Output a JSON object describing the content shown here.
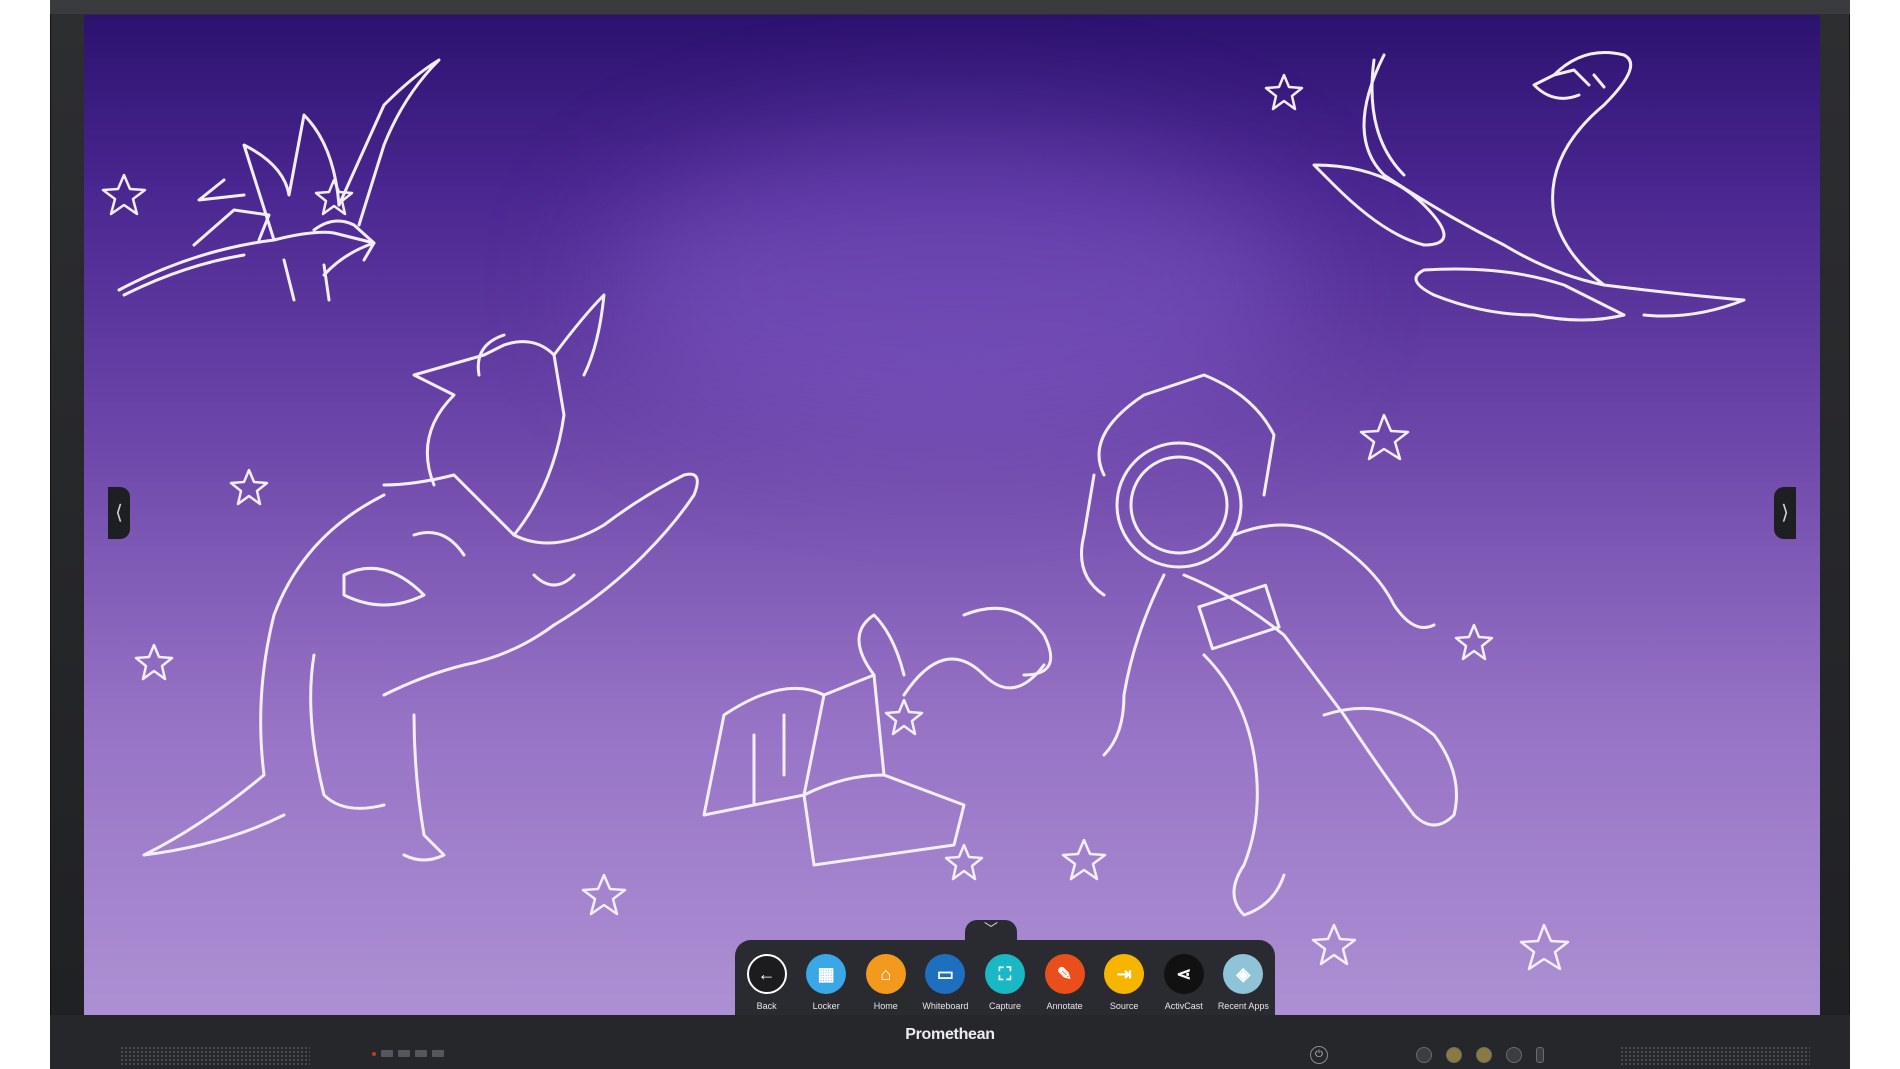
{
  "panel": {
    "brand": "Promethean"
  },
  "side_tabs": {
    "left_glyph": "⟨",
    "right_glyph": "⟩"
  },
  "dock": {
    "handle_glyph": "﹀",
    "items": [
      {
        "label": "Back",
        "icon": "back-arrow-icon",
        "color": "#1c1c1e",
        "glyph": "←"
      },
      {
        "label": "Locker",
        "icon": "locker-icon",
        "color": "#3aa7e6",
        "glyph": "▦"
      },
      {
        "label": "Home",
        "icon": "home-icon",
        "color": "#f39a1e",
        "glyph": "⌂"
      },
      {
        "label": "Whiteboard",
        "icon": "whiteboard-icon",
        "color": "#1f6fc0",
        "glyph": "▭"
      },
      {
        "label": "Capture",
        "icon": "capture-icon",
        "color": "#19b8c4",
        "glyph": "⛶"
      },
      {
        "label": "Annotate",
        "icon": "annotate-icon",
        "color": "#e94e1b",
        "glyph": "✎"
      },
      {
        "label": "Source",
        "icon": "source-icon",
        "color": "#f7b500",
        "glyph": "⇥"
      },
      {
        "label": "ActivCast",
        "icon": "share-icon",
        "color": "#111111",
        "glyph": "⋖"
      },
      {
        "label": "Recent Apps",
        "icon": "recent-apps-icon",
        "color": "#8fc3d8",
        "glyph": "◈"
      }
    ]
  },
  "wallpaper": {
    "theme": "chalk sketches: pterodactyl, plesiosaur, triceratops, open book, astronaut, stars",
    "gradient_top": "#2c126f",
    "gradient_bottom": "#ad90d3"
  }
}
